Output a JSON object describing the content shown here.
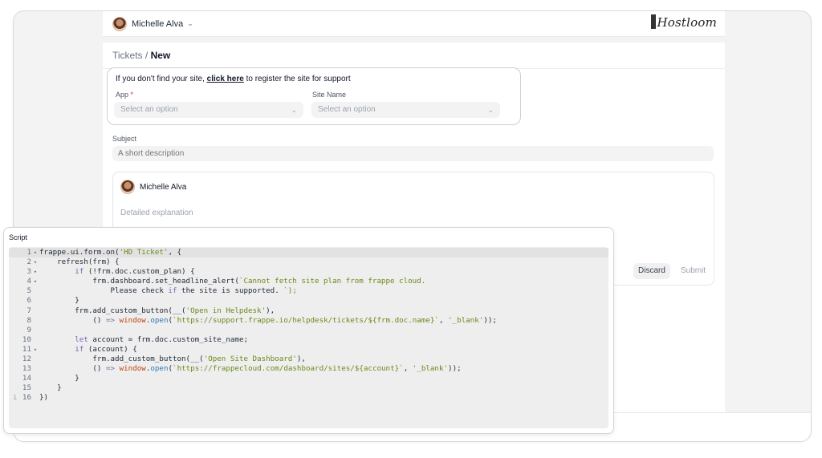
{
  "header": {
    "user_name": "Michelle Alva",
    "logo_text": "Hostloom"
  },
  "breadcrumb": {
    "parent": "Tickets",
    "separator": "/",
    "current": "New"
  },
  "site_notice": {
    "prefix": "If you don't find your site,",
    "link": "click here",
    "suffix": "to register the site for support"
  },
  "fields": {
    "app_label": "App",
    "app_required": "*",
    "app_placeholder": "Select an option",
    "site_label": "Site Name",
    "site_placeholder": "Select an option",
    "subject_label": "Subject",
    "subject_placeholder": "A short description"
  },
  "editor": {
    "user_name": "Michelle Alva",
    "placeholder": "Detailed explanation",
    "discard_label": "Discard",
    "submit_label": "Submit"
  },
  "script": {
    "title": "Script",
    "lines": [
      {
        "n": "1",
        "fold": true,
        "code": "frappe.ui.form.on('HD Ticket', {"
      },
      {
        "n": "2",
        "fold": true,
        "code": "    refresh(frm) {"
      },
      {
        "n": "3",
        "fold": true,
        "code": "        if (!frm.doc.custom_plan) {"
      },
      {
        "n": "4",
        "fold": true,
        "code": "            frm.dashboard.set_headline_alert(`Cannot fetch site plan from frappe cloud."
      },
      {
        "n": "5",
        "fold": false,
        "code": "                Please check if the site is supported. `);"
      },
      {
        "n": "6",
        "fold": false,
        "code": "        }"
      },
      {
        "n": "7",
        "fold": false,
        "code": "        frm.add_custom_button(__('Open in Helpdesk'),"
      },
      {
        "n": "8",
        "fold": false,
        "code": "            () => window.open(`https://support.frappe.io/helpdesk/tickets/${frm.doc.name}`, '_blank'));"
      },
      {
        "n": "9",
        "fold": false,
        "code": ""
      },
      {
        "n": "10",
        "fold": false,
        "code": "        let account = frm.doc.custom_site_name;"
      },
      {
        "n": "11",
        "fold": true,
        "code": "        if (account) {"
      },
      {
        "n": "12",
        "fold": false,
        "code": "            frm.add_custom_button(__('Open Site Dashboard'),"
      },
      {
        "n": "13",
        "fold": false,
        "code": "            () => window.open(`https://frappecloud.com/dashboard/sites/${account}`, '_blank'));"
      },
      {
        "n": "14",
        "fold": false,
        "code": "        }"
      },
      {
        "n": "15",
        "fold": false,
        "code": "    }"
      },
      {
        "n": "16",
        "fold": false,
        "code": "})"
      }
    ],
    "warning_glyph": "i"
  },
  "colors": {
    "string": "#6a8a1a",
    "keyword": "#7b68ae",
    "method": "#2b7bb9",
    "required": "#e11d48"
  }
}
